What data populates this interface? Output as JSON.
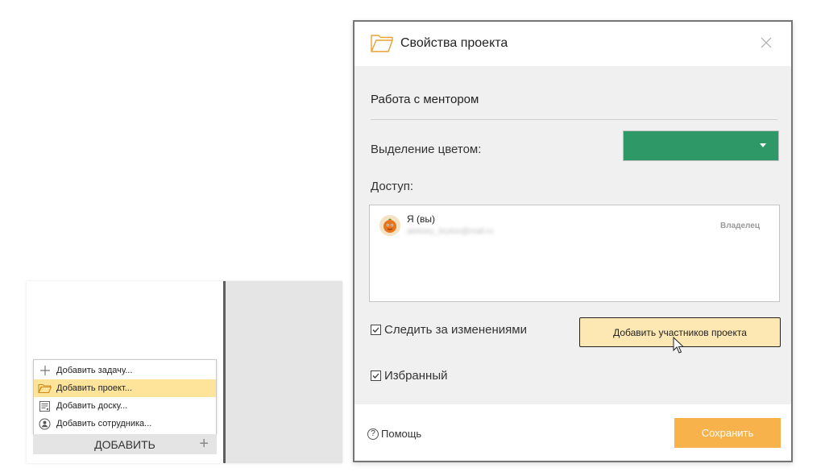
{
  "mini_menu": {
    "items": [
      {
        "label": "Добавить задачу...",
        "icon": "plus-icon"
      },
      {
        "label": "Добавить проект...",
        "icon": "folder-icon"
      },
      {
        "label": "Добавить доску...",
        "icon": "board-icon"
      },
      {
        "label": "Добавить сотрудника...",
        "icon": "person-icon"
      }
    ],
    "selected_index": 1,
    "add_button_label": "ДОБАВИТЬ"
  },
  "dialog": {
    "title": "Свойства проекта",
    "project_name": "Работа с ментором",
    "color_label": "Выделение цветом:",
    "selected_color": "#2e9966",
    "access_label": "Доступ:",
    "members": [
      {
        "name": "Я (вы)",
        "email": "aleksey_bryton@mail.ru",
        "role": "Владелец"
      }
    ],
    "follow_changes_label": "Следить за изменениями",
    "follow_changes_checked": true,
    "add_members_label": "Добавить участников проекта",
    "favorite_label": "Избранный",
    "favorite_checked": true,
    "help_label": "Помощь",
    "save_label": "Сохранить"
  },
  "colors": {
    "accent_orange": "#f7b24b",
    "highlight_yellow": "#fde49a",
    "button_yellow": "#fde8b4"
  }
}
